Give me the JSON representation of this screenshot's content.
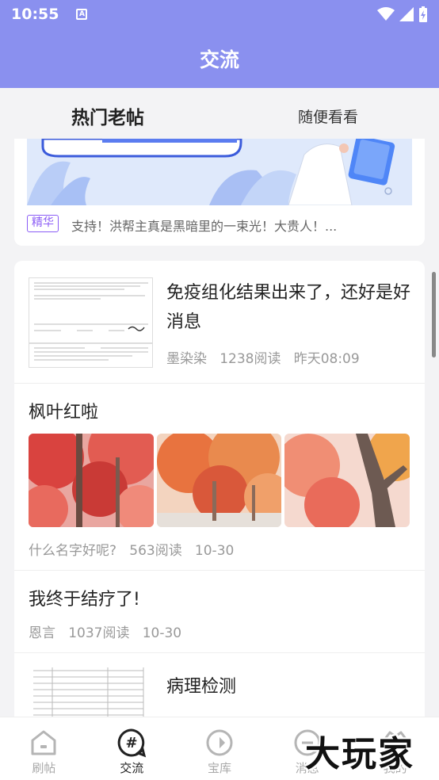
{
  "status_bar": {
    "time": "10:55",
    "notif_icon_letter": "A"
  },
  "header": {
    "title": "交流"
  },
  "tabs": {
    "hot": "热门老帖",
    "random": "随便看看"
  },
  "top_post": {
    "tag": "精华",
    "text": "支持！洪帮主真是黑暗里的一束光！大贵人！..."
  },
  "posts": [
    {
      "title": "免疫组化结果出来了，还好是好消息",
      "author": "墨染染",
      "reads": "1238阅读",
      "time": "昨天08:09"
    },
    {
      "title": "枫叶红啦",
      "author": "什么名字好呢?",
      "reads": "563阅读",
      "time": "10-30"
    },
    {
      "title": "我终于结疗了!",
      "author": "恩言",
      "reads": "1037阅读",
      "time": "10-30"
    },
    {
      "title": "病理检测"
    }
  ],
  "bottom_nav": [
    {
      "label": "刷帖",
      "icon": "house-icon"
    },
    {
      "label": "交流",
      "icon": "hash-chat-icon"
    },
    {
      "label": "宝库",
      "icon": "compass-icon"
    },
    {
      "label": "消息",
      "icon": "message-icon"
    },
    {
      "label": "我的",
      "icon": "profile-icon"
    }
  ],
  "watermark": "大玩家",
  "colors": {
    "accent": "#8a90ef",
    "tag_purple": "#8b5cf6"
  }
}
